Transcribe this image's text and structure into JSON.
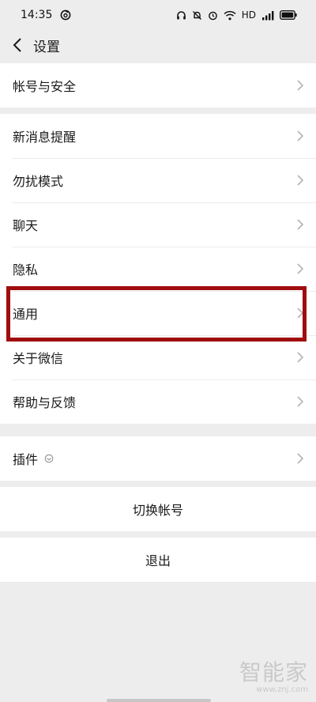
{
  "status_bar": {
    "time": "14:35",
    "network_label": "HD",
    "icons": [
      "netease-music-icon",
      "headphones-icon",
      "bell-off-icon",
      "alarm-icon",
      "wifi-icon",
      "signal-4g-icon",
      "battery-icon"
    ]
  },
  "nav": {
    "title": "设置"
  },
  "groups": {
    "account": {
      "label": "帐号与安全"
    },
    "main": [
      {
        "label": "新消息提醒"
      },
      {
        "label": "勿扰模式"
      },
      {
        "label": "聊天"
      },
      {
        "label": "隐私"
      },
      {
        "label": "通用"
      },
      {
        "label": "关于微信"
      },
      {
        "label": "帮助与反馈"
      }
    ],
    "plugins": {
      "label": "插件"
    }
  },
  "actions": {
    "switch_account": "切换帐号",
    "logout": "退出"
  },
  "watermark": {
    "main": "智能家",
    "sub": "www.znj.com"
  },
  "colors": {
    "highlight": "#a00d0f",
    "background": "#ededed"
  }
}
